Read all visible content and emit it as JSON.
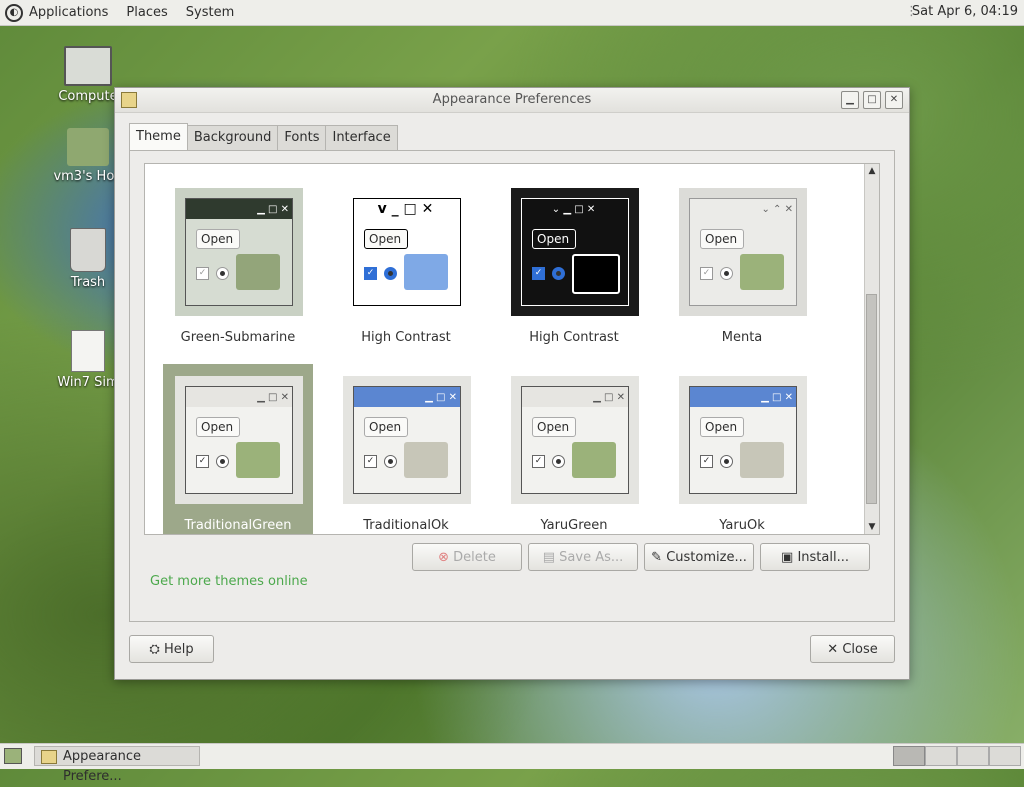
{
  "topbar": {
    "menus": [
      "Applications",
      "Places",
      "System"
    ],
    "clock": "Sat Apr  6, 04:19"
  },
  "desktop": {
    "icons": [
      "Compute",
      "vm3's Hon",
      "Trash",
      "Win7 Sim"
    ]
  },
  "window": {
    "title": "Appearance Preferences",
    "tabs": [
      "Theme",
      "Background",
      "Fonts",
      "Interface"
    ],
    "active_tab": "Theme",
    "themes": [
      {
        "name": "Green-Submarine",
        "open_label": "Open"
      },
      {
        "name": "High Contrast",
        "open_label": "Open"
      },
      {
        "name": "High Contrast",
        "open_label": "Open"
      },
      {
        "name": "Menta",
        "open_label": "Open"
      },
      {
        "name": "TraditionalGreen",
        "open_label": "Open",
        "selected": true
      },
      {
        "name": "TraditionalOk",
        "open_label": "Open"
      },
      {
        "name": "YaruGreen",
        "open_label": "Open"
      },
      {
        "name": "YaruOk",
        "open_label": "Open"
      }
    ],
    "buttons": {
      "delete": "Delete",
      "save_as": "Save As...",
      "customize": "Customize...",
      "install": "Install..."
    },
    "link": "Get more themes online",
    "help": "Help",
    "close": "Close"
  },
  "taskbar": {
    "task": "Appearance Prefere..."
  },
  "colors": {
    "selected": "#9da88a",
    "link": "#4ca84c",
    "green_folder": "#9bb27a",
    "blue_bar": "#5b86d1"
  }
}
